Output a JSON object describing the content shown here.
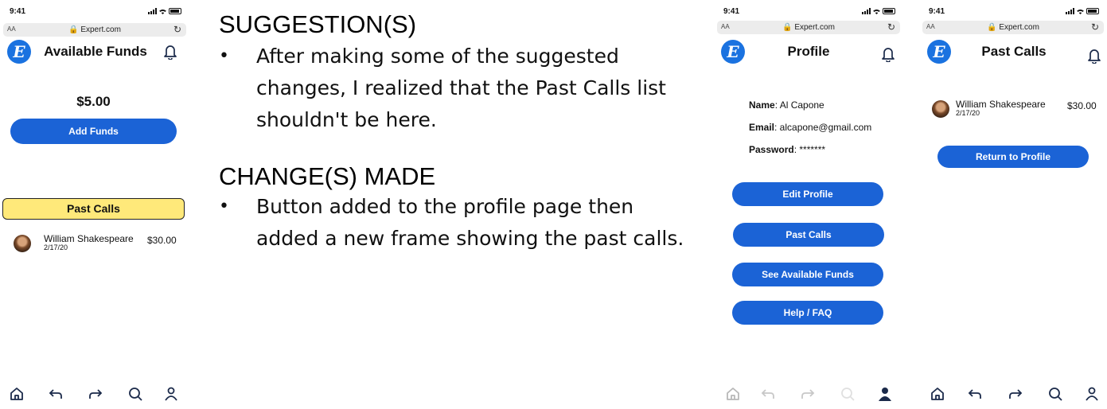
{
  "status": {
    "time": "9:41"
  },
  "browser": {
    "text_size": "AA",
    "url": "Expert.com"
  },
  "logo_letter": "E",
  "screen1": {
    "title": "Available Funds",
    "balance": "$5.00",
    "add_funds_label": "Add Funds",
    "past_calls_label": "Past Calls",
    "calls": [
      {
        "name": "William Shakespeare",
        "date": "2/17/20",
        "amount": "$30.00"
      }
    ]
  },
  "notes": {
    "suggestion_heading": "SUGGESTION(S)",
    "suggestion_text": "After making some of the suggested changes, I realized that the Past Calls list shouldn't be here.",
    "change_heading": "CHANGE(S) MADE",
    "change_text": "Button added to the profile page then added a new frame showing the past calls.",
    "bullet": "•"
  },
  "screen2": {
    "title": "Profile",
    "name_label": "Name",
    "name_value": ": Al Capone",
    "email_label": "Email",
    "email_value": ": alcapone@gmail.com",
    "password_label": "Password",
    "password_value": ": *******",
    "buttons": [
      "Edit Profile",
      "Past Calls",
      "See Available Funds",
      "Help / FAQ"
    ]
  },
  "screen3": {
    "title": "Past Calls",
    "calls": [
      {
        "name": "William Shakespeare",
        "date": "2/17/20",
        "amount": "$30.00"
      }
    ],
    "return_label": "Return to Profile"
  },
  "nav_icons": [
    "home-icon",
    "back-arrow-icon",
    "forward-arrow-icon",
    "search-icon",
    "profile-icon"
  ],
  "colors": {
    "accent": "#1b63d6",
    "logo": "#1a72e0",
    "highlight": "#ffe97a"
  }
}
